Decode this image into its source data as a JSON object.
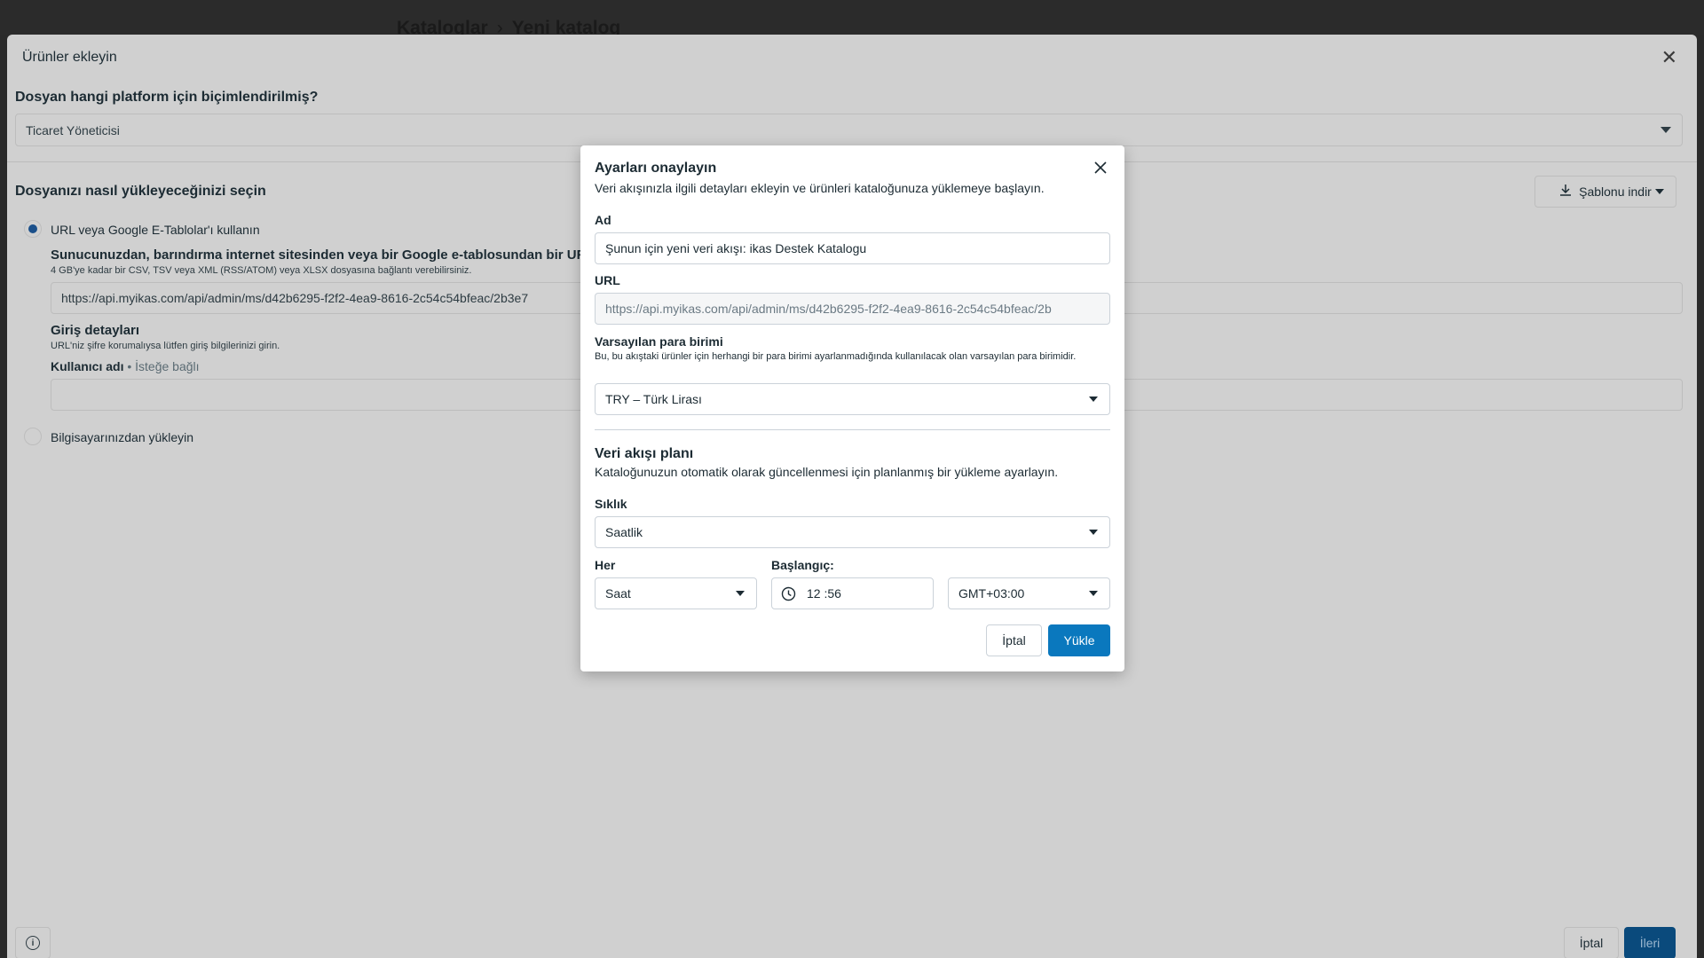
{
  "breadcrumb": {
    "parent": "Kataloglar",
    "current": "Yeni katalog"
  },
  "background": {
    "title": "Ürünler ekleyin",
    "platform_question": "Dosyan hangi platform için biçimlendirilmiş?",
    "platform_value": "Ticaret Yöneticisi",
    "upload_heading": "Dosyanızı nasıl yükleyeceğinizi seçin",
    "template_button": "Şablonu indir",
    "option_url": "URL veya Google E-Tablolar'ı kullanın",
    "url_bold": "Sunucunuzdan, barındırma internet sitesinden veya bir Google e-tablosundan bir URL",
    "url_help": "4 GB'ye kadar bir CSV, TSV veya XML (RSS/ATOM) veya XLSX dosyasına bağlantı verebilirsiniz.",
    "url_value": "https://api.myikas.com/api/admin/ms/d42b6295-f2f2-4ea9-8616-2c54c54bfeac/2b3e7",
    "login_heading": "Giriş detayları",
    "login_help": "URL'niz şifre korumalıysa lütfen giriş bilgilerinizi girin.",
    "username_label": "Kullanıcı adı",
    "username_dot": "•",
    "optional": "İsteğe bağlı",
    "option_computer": "Bilgisayarınızdan yükleyin",
    "info_glyph": "i",
    "cancel": "İptal",
    "next": "İleri"
  },
  "dialog": {
    "title": "Ayarları onaylayın",
    "subtitle": "Veri akışınızla ilgili detayları ekleyin ve ürünleri kataloğunuza yüklemeye başlayın.",
    "name_label": "Ad",
    "name_value": "Şunun için yeni veri akışı: ikas Destek Katalogu",
    "url_label": "URL",
    "url_value": "https://api.myikas.com/api/admin/ms/d42b6295-f2f2-4ea9-8616-2c54c54bfeac/2b",
    "currency_label": "Varsayılan para birimi",
    "currency_help": "Bu, bu akıştaki ürünler için herhangi bir para birimi ayarlanmadığında kullanılacak olan varsayılan para birimidir.",
    "currency_value": "TRY – Türk Lirası",
    "schedule_heading": "Veri akışı planı",
    "schedule_help": "Kataloğunuzun otomatik olarak güncellenmesi için planlanmış bir yükleme ayarlayın.",
    "frequency_label": "Sıklık",
    "frequency_value": "Saatlik",
    "every_label": "Her",
    "every_value": "Saat",
    "start_label": "Başlangıç:",
    "start_time": "12 :56",
    "timezone_value": "GMT+03:00",
    "cancel": "İptal",
    "upload": "Yükle"
  },
  "colors": {
    "primary": "#0a78be",
    "overlay": "#d0d0d0"
  }
}
